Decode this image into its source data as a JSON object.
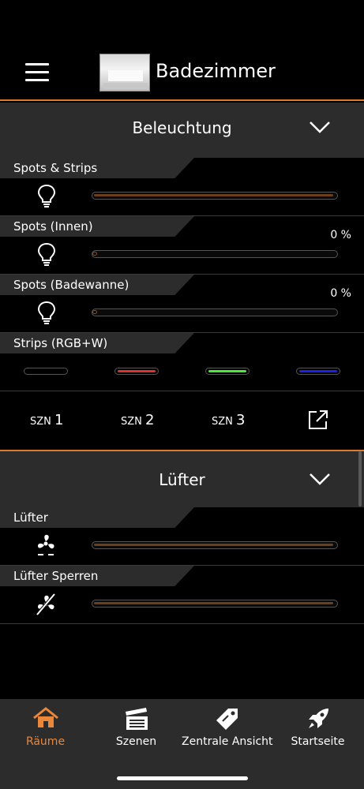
{
  "header": {
    "room_title": "Badezimmer"
  },
  "sections": [
    {
      "title": "Beleuchtung",
      "rows": [
        {
          "label": "Spots & Strips",
          "icon": "lightbulb-icon",
          "level": 1.0,
          "percent": ""
        },
        {
          "label": "Spots (Innen)",
          "icon": "lightbulb-icon",
          "level": 0.0,
          "percent": "0 %"
        },
        {
          "label": "Spots (Badewanne)",
          "icon": "lightbulb-icon",
          "level": 0.0,
          "percent": "0 %"
        }
      ],
      "rgb": {
        "label": "Strips (RGB+W)",
        "colors": [
          "#000000",
          "#e03030",
          "#44ee33",
          "#2020e8"
        ]
      },
      "scenes": [
        {
          "prefix": "SZN",
          "num": "1"
        },
        {
          "prefix": "SZN",
          "num": "2"
        },
        {
          "prefix": "SZN",
          "num": "3"
        }
      ]
    },
    {
      "title": "Lüfter",
      "rows": [
        {
          "label": "Lüfter",
          "icon": "fan-icon",
          "level": 1.0
        },
        {
          "label": "Lüfter Sperren",
          "icon": "fan-off-icon",
          "level": 1.0
        }
      ]
    }
  ],
  "tabbar": {
    "tabs": [
      {
        "label": "Räume",
        "icon": "home-icon",
        "active": true
      },
      {
        "label": "Szenen",
        "icon": "clapperboard-icon",
        "active": false
      },
      {
        "label": "Zentrale Ansicht",
        "icon": "tag-icon",
        "active": false
      },
      {
        "label": "Startseite",
        "icon": "rocket-icon",
        "active": false
      }
    ]
  },
  "colors": {
    "accent": "#e9873b",
    "panel": "#2c2c2c",
    "background": "#000000"
  }
}
